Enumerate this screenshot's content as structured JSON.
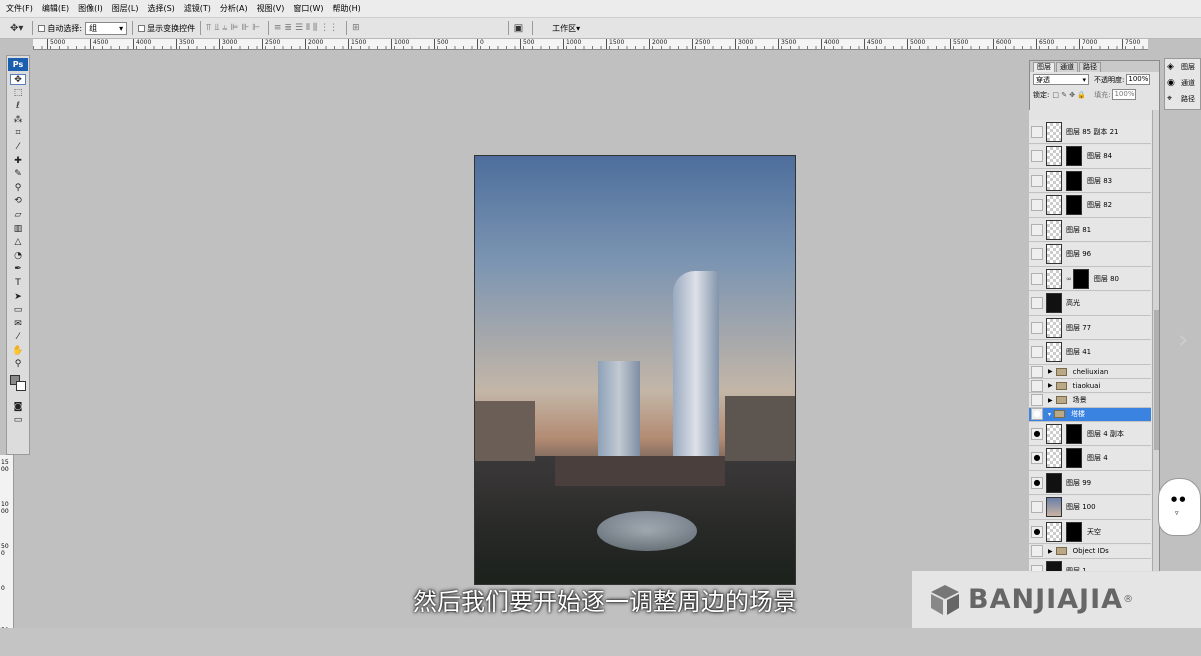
{
  "menu": [
    "文件(F)",
    "编辑(E)",
    "图像(I)",
    "图层(L)",
    "选择(S)",
    "滤镜(T)",
    "分析(A)",
    "视图(V)",
    "窗口(W)",
    "帮助(H)"
  ],
  "options": {
    "auto_select_label": "自动选择:",
    "auto_select_value": "组",
    "show_transform_label": "显示变换控件",
    "workspace_label": "工作区"
  },
  "ruler_labels": [
    "5000",
    "4500",
    "4000",
    "3500",
    "3000",
    "2500",
    "2000",
    "1500",
    "1000",
    "500",
    "0",
    "500",
    "1000",
    "1500",
    "2000",
    "2500",
    "3000",
    "3500",
    "4000",
    "4500",
    "5000",
    "5500",
    "6000",
    "6500",
    "7000",
    "7500"
  ],
  "vruler_labels": [
    "1500",
    "1000",
    "500",
    "0",
    "500"
  ],
  "toolbox": {
    "logo": "Ps"
  },
  "layers_panel": {
    "tabs": [
      "图层",
      "通道",
      "路径"
    ],
    "blend_mode": "穿透",
    "opacity_label": "不透明度:",
    "opacity_value": "100%",
    "lock_label": "锁定:",
    "fill_label": "填充:",
    "fill_value": "100%",
    "layers": [
      {
        "name": "图层 85 副本 21",
        "visible": false,
        "type": "pixel"
      },
      {
        "name": "图层 84",
        "visible": false,
        "type": "masked"
      },
      {
        "name": "图层 83",
        "visible": false,
        "type": "masked"
      },
      {
        "name": "图层 82",
        "visible": false,
        "type": "masked"
      },
      {
        "name": "图层 81",
        "visible": false,
        "type": "pixel"
      },
      {
        "name": "图层 96",
        "visible": false,
        "type": "pixel"
      },
      {
        "name": "图层 80",
        "visible": false,
        "type": "masked-linked"
      },
      {
        "name": "高光",
        "visible": false,
        "type": "dark"
      },
      {
        "name": "图层 77",
        "visible": false,
        "type": "pixel"
      },
      {
        "name": "图层 41",
        "visible": false,
        "type": "pixel"
      },
      {
        "name": "cheliuxian",
        "visible": false,
        "type": "group"
      },
      {
        "name": "tiaokuai",
        "visible": false,
        "type": "group"
      },
      {
        "name": "场景",
        "visible": false,
        "type": "group"
      },
      {
        "name": "塔楼",
        "visible": true,
        "type": "group-open",
        "selected": true
      },
      {
        "name": "图层 4 副本",
        "visible": true,
        "type": "masked"
      },
      {
        "name": "图层 4",
        "visible": true,
        "type": "masked"
      },
      {
        "name": "图层 99",
        "visible": true,
        "type": "dark"
      },
      {
        "name": "图层 100",
        "visible": false,
        "type": "photo"
      },
      {
        "name": "天空",
        "visible": true,
        "type": "masked"
      },
      {
        "name": "Object IDs",
        "visible": false,
        "type": "group"
      },
      {
        "name": "图层 1",
        "visible": false,
        "type": "dark"
      }
    ]
  },
  "mini_panel": [
    "图层",
    "通道",
    "路径"
  ],
  "subtitle": "然后我们要开始逐一调整周边的场景",
  "watermark": {
    "brand": "BANJIAJIA",
    "reg": "®"
  }
}
